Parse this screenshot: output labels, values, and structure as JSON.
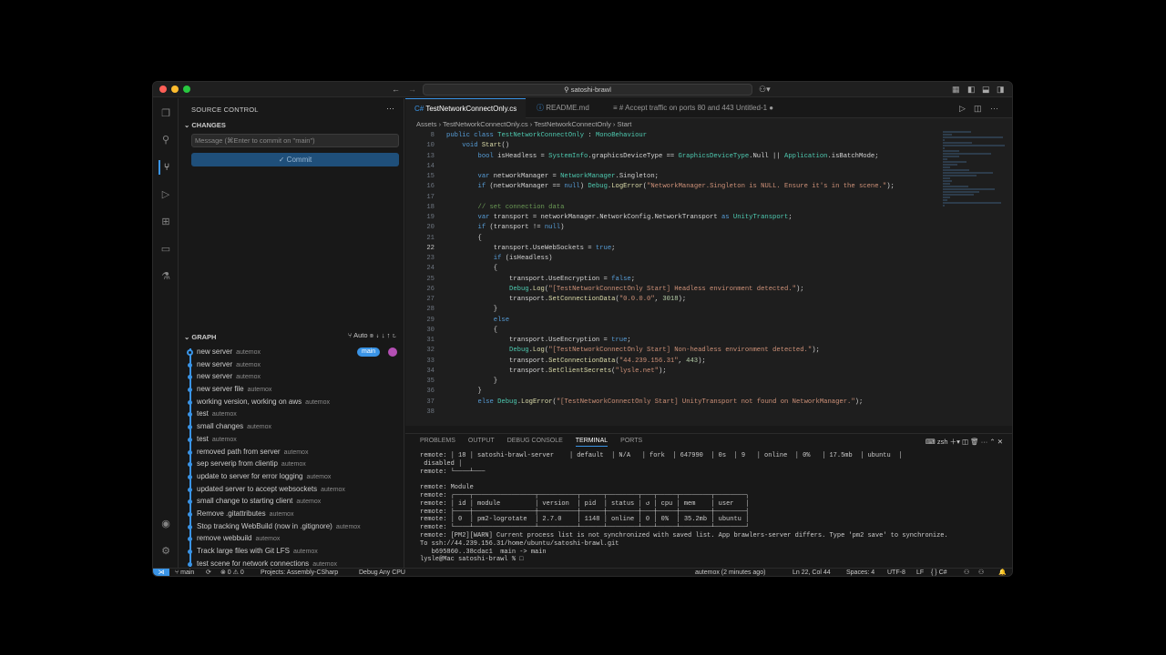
{
  "window": {
    "search": "satoshi-brawl",
    "traffic_lights": [
      "#ff5f57",
      "#febc2e",
      "#28c840"
    ],
    "accent": "#3a94e6"
  },
  "activity_bar": {
    "icons": [
      "files-icon",
      "search-icon",
      "source-control-icon",
      "run-debug-icon",
      "extensions-icon",
      "remote-explorer-icon",
      "testing-icon",
      "account-icon",
      "settings-gear-icon"
    ]
  },
  "sidebar": {
    "title": "SOURCE CONTROL",
    "more": "···",
    "changes_header": "CHANGES",
    "message_placeholder": "Message (⌘Enter to commit on \"main\")",
    "commit_label": "✓ Commit",
    "graph_header": "GRAPH",
    "graph_auto": "Auto",
    "commits": [
      {
        "msg": "new server",
        "author": "autemox"
      },
      {
        "msg": "new server",
        "author": "autemox"
      },
      {
        "msg": "new server",
        "author": "autemox"
      },
      {
        "msg": "new server file",
        "author": "autemox"
      },
      {
        "msg": "working version, working on aws",
        "author": "autemox"
      },
      {
        "msg": "test",
        "author": "autemox"
      },
      {
        "msg": "small changes",
        "author": "autemox"
      },
      {
        "msg": "test",
        "author": "autemox"
      },
      {
        "msg": "removed path from server",
        "author": "autemox"
      },
      {
        "msg": "sep serverip from clientip",
        "author": "autemox"
      },
      {
        "msg": "update to server for error logging",
        "author": "autemox"
      },
      {
        "msg": "updated server to accept websockets",
        "author": "autemox"
      },
      {
        "msg": "small change to starting client",
        "author": "autemox"
      },
      {
        "msg": "Remove .gitattributes",
        "author": "autemox"
      },
      {
        "msg": "Stop tracking WebBuild (now in .gitignore)",
        "author": "autemox"
      },
      {
        "msg": "remove webbuild",
        "author": "autemox"
      },
      {
        "msg": "Track large files with Git LFS",
        "author": "autemox"
      },
      {
        "msg": "test scene for network connections",
        "author": "autemox"
      }
    ],
    "branch_badge": "main"
  },
  "editor": {
    "tabs": [
      {
        "label": "TestNetworkConnectOnly.cs",
        "active": true
      },
      {
        "label": "README.md",
        "active": false
      },
      {
        "label": "# Accept traffic on ports 80 and 443  Untitled-1 ●",
        "active": false
      }
    ],
    "breadcrumb": "Assets  ›  TestNetworkConnectOnly.cs  ›  TestNetworkConnectOnly  ›  Start",
    "current_line": "22",
    "lines": [
      {
        "n": "8",
        "t": "public class TestNetworkConnectOnly : MonoBehaviour"
      },
      {
        "n": "10",
        "t": "    void Start()"
      },
      {
        "n": "13",
        "t": "        bool isHeadless = SystemInfo.graphicsDeviceType == GraphicsDeviceType.Null || Application.isBatchMode;"
      },
      {
        "n": "14",
        "t": ""
      },
      {
        "n": "15",
        "t": "        var networkManager = NetworkManager.Singleton;"
      },
      {
        "n": "16",
        "t": "        if (networkManager == null) Debug.LogError(\"NetworkManager.Singleton is NULL. Ensure it's in the scene.\");"
      },
      {
        "n": "17",
        "t": ""
      },
      {
        "n": "18",
        "t": "        // set connection data"
      },
      {
        "n": "19",
        "t": "        var transport = networkManager.NetworkConfig.NetworkTransport as UnityTransport;"
      },
      {
        "n": "20",
        "t": "        if (transport != null)"
      },
      {
        "n": "21",
        "t": "        {"
      },
      {
        "n": "22",
        "t": "            transport.UseWebSockets = true;"
      },
      {
        "n": "23",
        "t": "            if (isHeadless)"
      },
      {
        "n": "24",
        "t": "            {"
      },
      {
        "n": "25",
        "t": "                transport.UseEncryption = false;"
      },
      {
        "n": "26",
        "t": "                Debug.Log(\"[TestNetworkConnectOnly Start] Headless environment detected.\");"
      },
      {
        "n": "27",
        "t": "                transport.SetConnectionData(\"0.0.0.0\", 3018);"
      },
      {
        "n": "28",
        "t": "            }"
      },
      {
        "n": "29",
        "t": "            else"
      },
      {
        "n": "30",
        "t": "            {"
      },
      {
        "n": "31",
        "t": "                transport.UseEncryption = true;"
      },
      {
        "n": "32",
        "t": "                Debug.Log(\"[TestNetworkConnectOnly Start] Non-headless environment detected.\");"
      },
      {
        "n": "33",
        "t": "                transport.SetConnectionData(\"44.239.156.31\", 443);"
      },
      {
        "n": "34",
        "t": "                transport.SetClientSecrets(\"lysle.net\");"
      },
      {
        "n": "35",
        "t": "            }"
      },
      {
        "n": "36",
        "t": "        }"
      },
      {
        "n": "37",
        "t": "        else Debug.LogError(\"[TestNetworkConnectOnly Start] UnityTransport not found on NetworkManager.\");"
      },
      {
        "n": "38",
        "t": ""
      }
    ]
  },
  "panel": {
    "tabs": [
      "PROBLEMS",
      "OUTPUT",
      "DEBUG CONSOLE",
      "TERMINAL",
      "PORTS"
    ],
    "active_tab": "TERMINAL",
    "shell": "zsh",
    "terminal_lines": [
      "remote: │ 18 │ satoshi-brawl-server    │ default  │ N/A   │ fork  │ 647990  │ 0s  │ 9   │ online  │ 0%   │ 17.5mb  │ ubuntu  │",
      " disabled │",
      "remote: └────┴───",
      "",
      "remote: Module",
      "remote: ┌────┬────────────────┬──────────┬──────┬────────┬───┬─────┬────────┬────────┐",
      "remote: │ id │ module         │ version  │ pid  │ status │ ↺ │ cpu │ mem    │ user   │",
      "remote: ├────┼────────────────┼──────────┼──────┼────────┼───┼─────┼────────┼────────┤",
      "remote: │ 0  │ pm2-logrotate  │ 2.7.0    │ 1148 │ online │ 0 │ 0%  │ 35.2mb │ ubuntu │",
      "remote: └────┴────────────────┴──────────┴──────┴────────┴───┴─────┴────────┴────────┘",
      "remote: [PM2][WARN] Current process list is not synchronized with saved list. App brawlers-server differs. Type 'pm2 save' to synchronize.",
      "To ssh://44.239.156.31/home/ubuntu/satoshi-brawl.git",
      "   b695860..38cdac1  main -> main",
      "lysle@Mac satoshi-brawl % □"
    ]
  },
  "statusbar": {
    "branch": "main",
    "sync": "⟳",
    "problems": "⊗ 0 ⚠ 0",
    "projects": "Projects: Assembly-CSharp",
    "debug": "Debug Any CPU",
    "blame": "autemox (2 minutes ago)",
    "position": "Ln 22, Col 44",
    "spaces": "Spaces: 4",
    "encoding": "UTF-8",
    "eol": "LF",
    "lang": "{ } C#"
  }
}
